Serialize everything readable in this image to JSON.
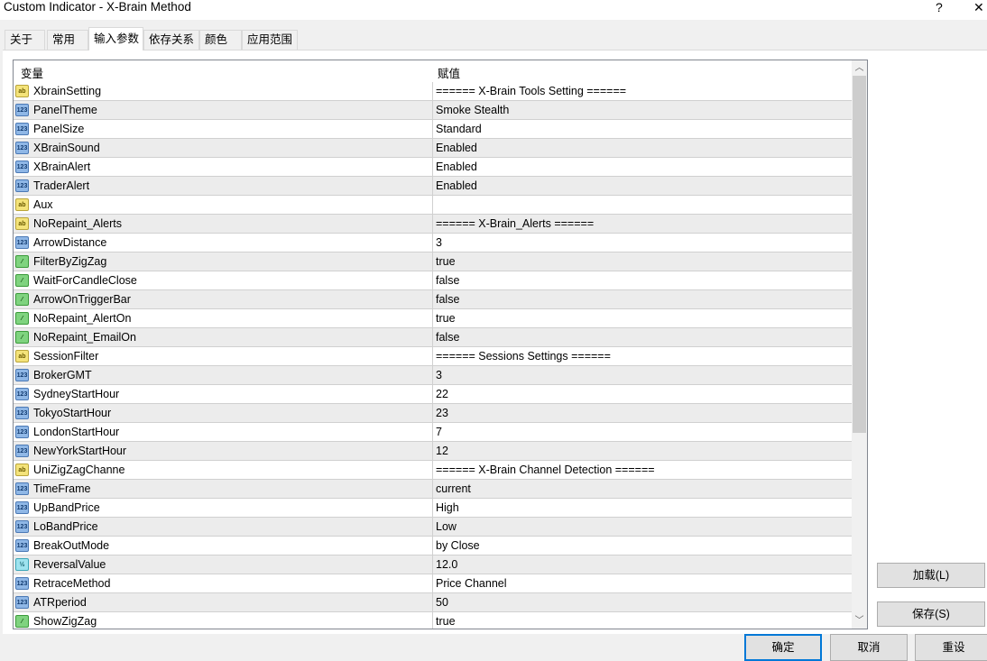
{
  "window": {
    "title": "Custom Indicator - X-Brain Method",
    "help": "?",
    "close": "✕"
  },
  "tabs": [
    "关于",
    "常用",
    "输入参数",
    "依存关系",
    "颜色",
    "应用范围"
  ],
  "grid": {
    "col_variable": "变量",
    "col_value": "赋值",
    "rows": [
      {
        "type": "ab",
        "name": "XbrainSetting",
        "value": "====== X-Brain Tools Setting ======"
      },
      {
        "type": "n",
        "name": "PanelTheme",
        "value": "Smoke Stealth"
      },
      {
        "type": "n",
        "name": "PanelSize",
        "value": "Standard"
      },
      {
        "type": "n",
        "name": "XBrainSound",
        "value": "Enabled"
      },
      {
        "type": "n",
        "name": "XBrainAlert",
        "value": "Enabled"
      },
      {
        "type": "n",
        "name": "TraderAlert",
        "value": "Enabled"
      },
      {
        "type": "ab",
        "name": "Aux",
        "value": ""
      },
      {
        "type": "ab",
        "name": "NoRepaint_Alerts",
        "value": "====== X-Brain_Alerts ======"
      },
      {
        "type": "n",
        "name": "ArrowDistance",
        "value": "3"
      },
      {
        "type": "b",
        "name": "FilterByZigZag",
        "value": "true"
      },
      {
        "type": "b",
        "name": "WaitForCandleClose",
        "value": "false"
      },
      {
        "type": "b",
        "name": "ArrowOnTriggerBar",
        "value": "false"
      },
      {
        "type": "b",
        "name": "NoRepaint_AlertOn",
        "value": "true"
      },
      {
        "type": "b",
        "name": "NoRepaint_EmailOn",
        "value": "false"
      },
      {
        "type": "ab",
        "name": "SessionFilter",
        "value": "====== Sessions Settings ======"
      },
      {
        "type": "n",
        "name": "BrokerGMT",
        "value": "3"
      },
      {
        "type": "n",
        "name": "SydneyStartHour",
        "value": "22"
      },
      {
        "type": "n",
        "name": "TokyoStartHour",
        "value": "23"
      },
      {
        "type": "n",
        "name": "LondonStartHour",
        "value": "7"
      },
      {
        "type": "n",
        "name": "NewYorkStartHour",
        "value": "12"
      },
      {
        "type": "ab",
        "name": "UniZigZagChanne",
        "value": "====== X-Brain Channel Detection ======"
      },
      {
        "type": "n",
        "name": "TimeFrame",
        "value": "current"
      },
      {
        "type": "n",
        "name": "UpBandPrice",
        "value": "High"
      },
      {
        "type": "n",
        "name": "LoBandPrice",
        "value": "Low"
      },
      {
        "type": "n",
        "name": "BreakOutMode",
        "value": "by Close"
      },
      {
        "type": "d",
        "name": "ReversalValue",
        "value": "12.0"
      },
      {
        "type": "n",
        "name": "RetraceMethod",
        "value": "Price Channel"
      },
      {
        "type": "n",
        "name": "ATRperiod",
        "value": "50"
      },
      {
        "type": "b",
        "name": "ShowZigZag",
        "value": "true"
      }
    ]
  },
  "icons": {
    "ab": "ab",
    "n": "123",
    "b": "⁄",
    "d": "½"
  },
  "buttons": {
    "load": "加载(L)",
    "save": "保存(S)",
    "ok": "确定",
    "cancel": "取消",
    "reset": "重设"
  }
}
